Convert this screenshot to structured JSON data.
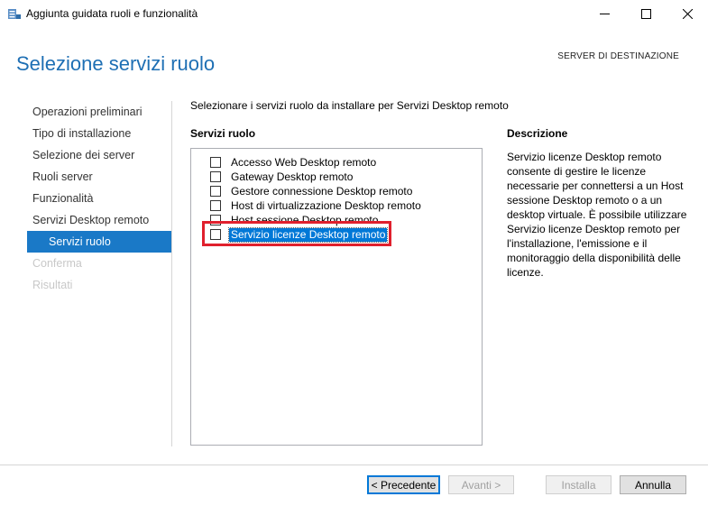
{
  "window": {
    "title": "Aggiunta guidata ruoli e funzionalità",
    "minimize": "—",
    "maximize": "☐",
    "close": "✕"
  },
  "header": {
    "title": "Selezione servizi ruolo",
    "destination": "SERVER DI DESTINAZIONE"
  },
  "nav": {
    "items": [
      {
        "label": "Operazioni preliminari",
        "state": "normal"
      },
      {
        "label": "Tipo di installazione",
        "state": "normal"
      },
      {
        "label": "Selezione dei server",
        "state": "normal"
      },
      {
        "label": "Ruoli server",
        "state": "normal"
      },
      {
        "label": "Funzionalità",
        "state": "normal"
      },
      {
        "label": "Servizi Desktop remoto",
        "state": "normal"
      },
      {
        "label": "Servizi ruolo",
        "state": "selected"
      },
      {
        "label": "Conferma",
        "state": "disabled"
      },
      {
        "label": "Risultati",
        "state": "disabled"
      }
    ]
  },
  "main": {
    "instruction": "Selezionare i servizi ruolo da installare per Servizi Desktop remoto",
    "roles_heading": "Servizi ruolo",
    "roles": [
      {
        "label": "Accesso Web Desktop remoto",
        "checked": false
      },
      {
        "label": "Gateway Desktop remoto",
        "checked": false
      },
      {
        "label": "Gestore connessione Desktop remoto",
        "checked": false
      },
      {
        "label": "Host di virtualizzazione Desktop remoto",
        "checked": false
      },
      {
        "label": "Host sessione Desktop remoto",
        "checked": false
      },
      {
        "label": "Servizio licenze Desktop remoto",
        "checked": false,
        "highlighted": true
      }
    ],
    "description_heading": "Descrizione",
    "description": "Servizio licenze Desktop remoto consente di gestire le licenze necessarie per connettersi a un Host sessione Desktop remoto o a un desktop virtuale. È possibile utilizzare Servizio licenze Desktop remoto per l'installazione, l'emissione e il monitoraggio della disponibilità delle licenze."
  },
  "footer": {
    "previous": "< Precedente",
    "next": "Avanti >",
    "install": "Installa",
    "cancel": "Annulla"
  },
  "colors": {
    "accent": "#1a79c7",
    "highlight_box": "#e0202d",
    "title_blue": "#1e6fb4"
  }
}
